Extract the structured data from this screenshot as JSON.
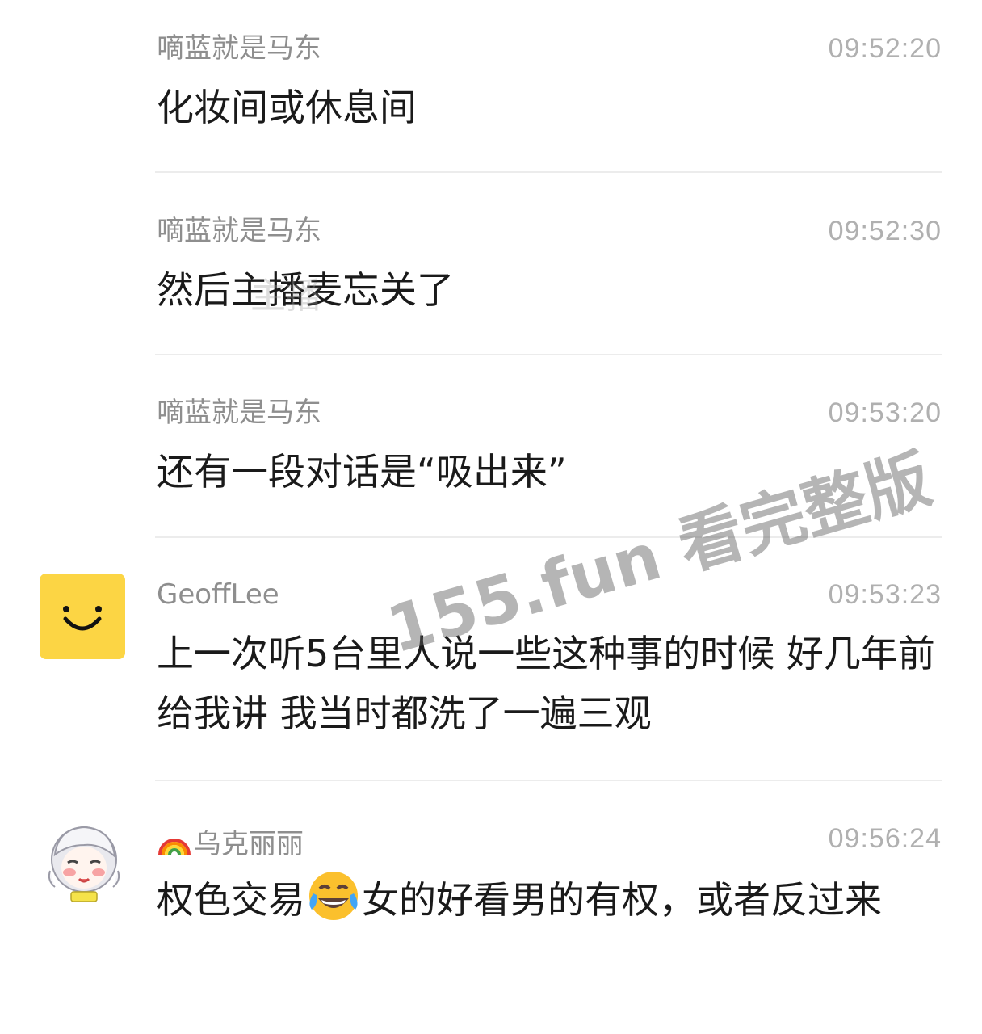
{
  "messages": [
    {
      "sender": "嘀蓝就是马东",
      "time": "09:52:20",
      "text": "化妆间或休息间"
    },
    {
      "sender": "嘀蓝就是马东",
      "time": "09:52:30",
      "text": "然后主播麦忘关了"
    },
    {
      "sender": "嘀蓝就是马东",
      "time": "09:53:20",
      "text": "还有一段对话是“吸出来”"
    },
    {
      "sender": "GeoffLee",
      "time": "09:53:23",
      "text": "上一次听5台里人说一些这种事的时候 好几年前给我讲 我当时都洗了一遍三观"
    },
    {
      "sender": "乌克丽丽",
      "time": "09:56:24",
      "text_before": "权色交易",
      "text_after": "女的好看男的有权，或者反过来"
    }
  ],
  "watermark": "155.fun 看完整版",
  "ghost_watermark": "主播"
}
